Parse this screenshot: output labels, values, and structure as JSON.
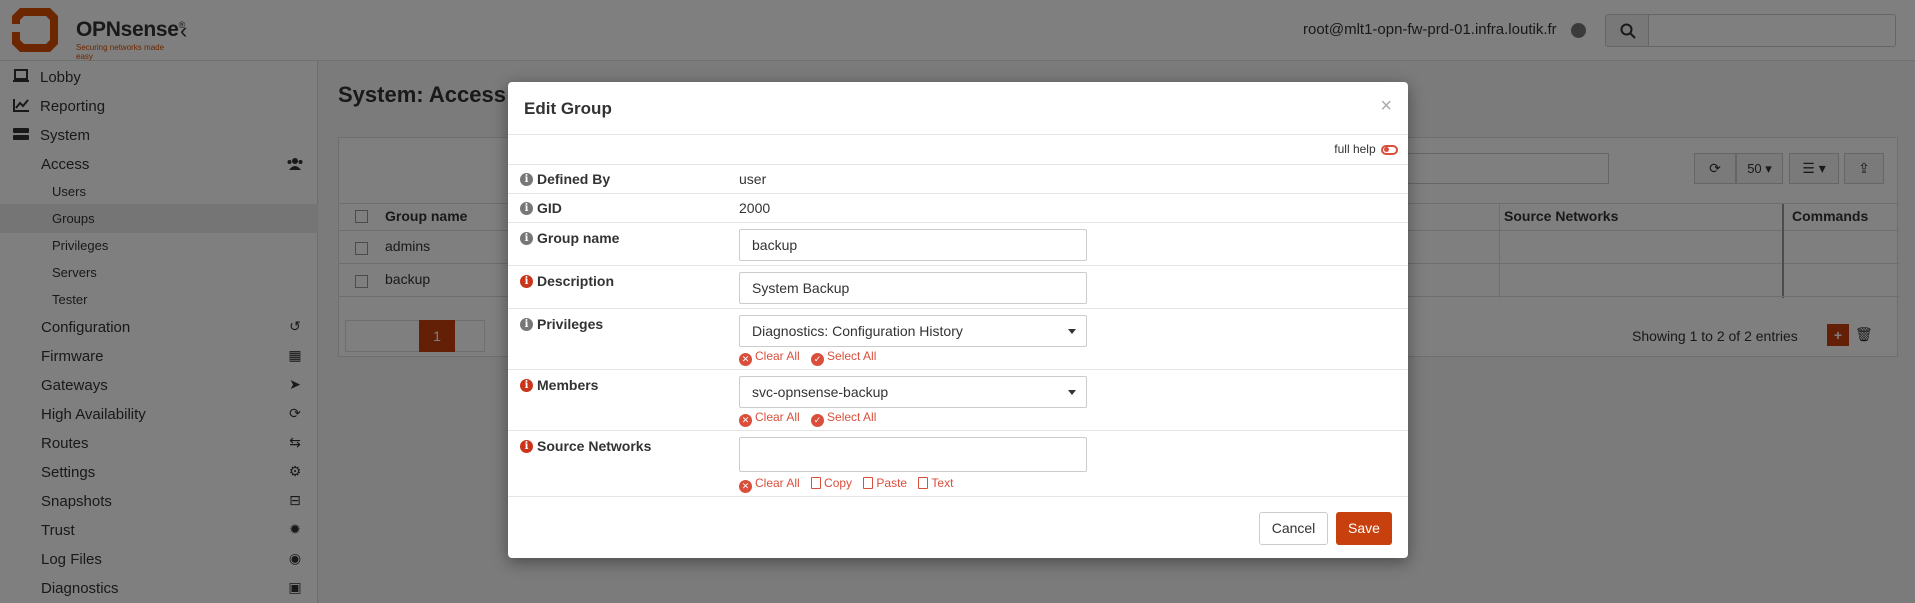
{
  "header": {
    "brand": "OPNsense",
    "brand_mark": "®",
    "tagline": "Securing networks made easy",
    "user": "root@mlt1-opn-fw-prd-01.infra.loutik.fr",
    "search_placeholder": ""
  },
  "sidebar": {
    "items": [
      {
        "label": "Lobby",
        "icon": "laptop-icon"
      },
      {
        "label": "Reporting",
        "icon": "chart-icon"
      },
      {
        "label": "System",
        "icon": "server-icon"
      },
      {
        "label": "Access",
        "icon": "users-icon"
      },
      {
        "label": "Users"
      },
      {
        "label": "Groups"
      },
      {
        "label": "Privileges"
      },
      {
        "label": "Servers"
      },
      {
        "label": "Tester"
      },
      {
        "label": "Configuration",
        "icon": "history-icon"
      },
      {
        "label": "Firmware",
        "icon": "calculator-icon"
      },
      {
        "label": "Gateways",
        "icon": "location-arrow-icon"
      },
      {
        "label": "High Availability",
        "icon": "refresh-icon"
      },
      {
        "label": "Routes",
        "icon": "signs-icon"
      },
      {
        "label": "Settings",
        "icon": "cogs-icon"
      },
      {
        "label": "Snapshots",
        "icon": "drive-icon"
      },
      {
        "label": "Trust",
        "icon": "certificate-icon"
      },
      {
        "label": "Log Files",
        "icon": "eye-icon"
      },
      {
        "label": "Diagnostics",
        "icon": "medkit-icon"
      }
    ]
  },
  "page": {
    "title": "System: Access:",
    "col_group_name": "Group name",
    "col_source_networks": "Source Networks",
    "col_commands": "Commands",
    "rows": [
      "admins",
      "backup"
    ],
    "page_size": "50",
    "pager_current": "1",
    "showing": "Showing 1 to 2 of 2 entries"
  },
  "modal": {
    "title": "Edit Group",
    "close": "×",
    "full_help": "full help",
    "fields": {
      "defined_by": {
        "label": "Defined By",
        "value": "user"
      },
      "gid": {
        "label": "GID",
        "value": "2000"
      },
      "group_name": {
        "label": "Group name",
        "value": "backup"
      },
      "description": {
        "label": "Description",
        "value": "System Backup"
      },
      "privileges": {
        "label": "Privileges",
        "value": "Diagnostics: Configuration History"
      },
      "members": {
        "label": "Members",
        "value": "svc-opnsense-backup"
      },
      "source_networks": {
        "label": "Source Networks",
        "value": ""
      }
    },
    "tools": {
      "clear_all": "Clear All",
      "select_all": "Select All",
      "copy": "Copy",
      "paste": "Paste",
      "text": "Text"
    },
    "cancel": "Cancel",
    "save": "Save"
  },
  "colors": {
    "accent": "#d94f00",
    "save": "#c9400f",
    "info_red": "#c9341b",
    "tool_red": "#d94f3b"
  }
}
